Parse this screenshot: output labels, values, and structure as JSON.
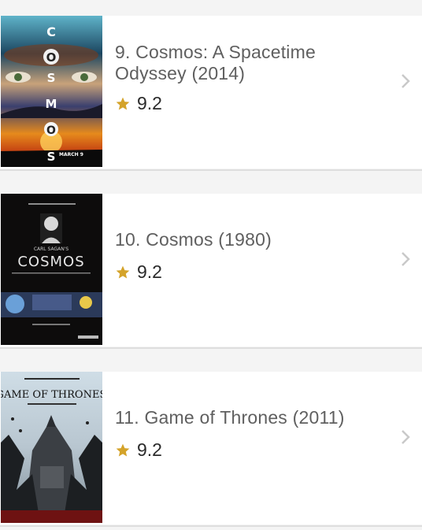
{
  "items": [
    {
      "title": "9. Cosmos: A Spacetime Odyssey (2014)",
      "rating": "9.2",
      "poster_icon": "cosmos-2014-poster",
      "poster_text": "MARCH 9"
    },
    {
      "title": "10. Cosmos (1980)",
      "rating": "9.2",
      "poster_icon": "cosmos-1980-poster",
      "poster_text": "CARL SAGAN'S COSMOS"
    },
    {
      "title": "11. Game of Thrones (2011)",
      "rating": "9.2",
      "poster_icon": "game-of-thrones-poster",
      "poster_text": "GAME OF THRONES"
    }
  ],
  "colors": {
    "star": "#d4a32a",
    "chevron": "#c9c9c9",
    "title": "#5f5f5f",
    "rating": "#2a2a2a",
    "divider": "#dedede"
  },
  "icons": {
    "rating": "star-icon",
    "navigate": "chevron-right-icon"
  }
}
